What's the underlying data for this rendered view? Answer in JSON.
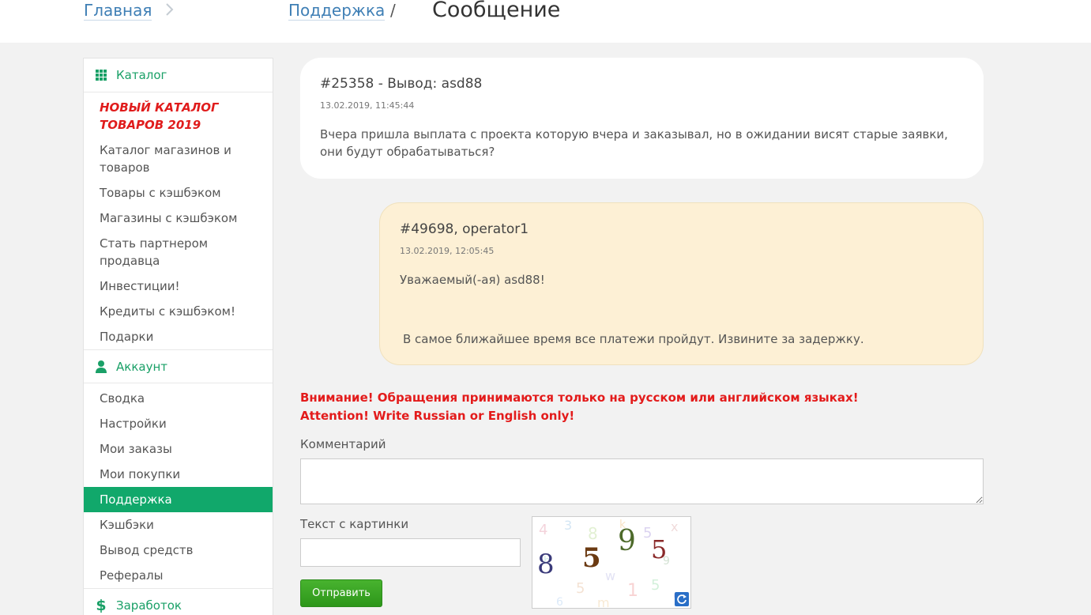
{
  "breadcrumb": {
    "home": "Главная",
    "support": "Поддержка",
    "separator": "/",
    "title": "Сообщение"
  },
  "sidebar": {
    "catalog": {
      "title": "Каталог",
      "items": [
        {
          "label": "НОВЫЙ КАТАЛОГ ТОВАРОВ 2019"
        },
        {
          "label": "Каталог магазинов и товаров"
        },
        {
          "label": "Товары с кэшбэком"
        },
        {
          "label": "Магазины с кэшбэком"
        },
        {
          "label": "Стать партнером продавца"
        },
        {
          "label": "Инвестиции!"
        },
        {
          "label": "Кредиты с кэшбэком!"
        },
        {
          "label": "Подарки"
        }
      ]
    },
    "account": {
      "title": "Аккаунт",
      "items": [
        {
          "label": "Сводка"
        },
        {
          "label": "Настройки"
        },
        {
          "label": "Мои заказы"
        },
        {
          "label": "Мои покупки"
        },
        {
          "label": "Поддержка"
        },
        {
          "label": "Кэшбэки"
        },
        {
          "label": "Вывод средств"
        },
        {
          "label": "Рефералы"
        }
      ]
    },
    "earnings": {
      "title": "Заработок"
    }
  },
  "messages": [
    {
      "title": "#25358 - Вывод: asd88",
      "date": "13.02.2019, 11:45:44",
      "body": "Вчера пришла выплата с проекта которую вчера и заказывал, но в ожидании висят старые заявки, они будут обрабатываться?"
    },
    {
      "title": "#49698, operator1",
      "date": "13.02.2019, 12:05:45",
      "greeting": "Уважаемый(-ая) asd88!",
      "body": "В самое ближайшее время все платежи пройдут. Извините за задержку."
    }
  ],
  "form": {
    "warning_ru": "Внимание! Обращения принимаются только на русском или английском языках!",
    "warning_en": "Attention! Write Russian or English only!",
    "comment_label": "Комментарий",
    "captcha_label": "Текст с картинки",
    "submit_label": "Отправить",
    "captcha_digits": [
      "8",
      "5",
      "9",
      "5"
    ]
  },
  "colors": {
    "accent_green": "#11a86b",
    "link_blue": "#3f7fb5",
    "warning_red": "#e31b1b",
    "operator_bubble": "#fdf0d5"
  }
}
